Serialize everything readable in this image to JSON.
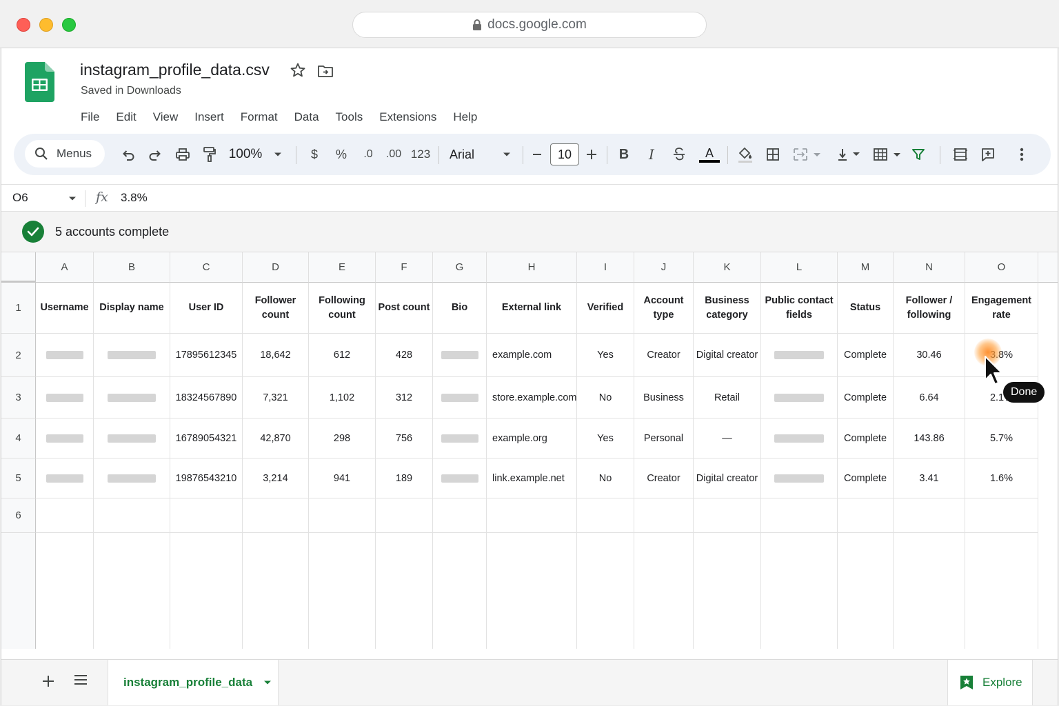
{
  "browser": {
    "url": "docs.google.com"
  },
  "doc": {
    "title": "instagram_profile_data.csv",
    "subtitle": "Saved in Downloads"
  },
  "menu": [
    "File",
    "Edit",
    "View",
    "Insert",
    "Format",
    "Data",
    "Tools",
    "Extensions",
    "Help"
  ],
  "toolbar": {
    "menus_label": "Menus",
    "zoom": "100%",
    "currency": "$",
    "percent": "%",
    "decrease_decimal": ".0",
    "increase_decimal": ".00",
    "number_format": "123",
    "font": "Arial",
    "font_size": "10",
    "bold": "B",
    "italic": "I",
    "text_color_letter": "A"
  },
  "formula_bar": {
    "cell_ref": "O6",
    "fx": "fx",
    "value": "3.8%"
  },
  "status": {
    "text": "5 accounts complete",
    "color": "#188038"
  },
  "columns": [
    "A",
    "B",
    "C",
    "D",
    "E",
    "F",
    "G",
    "H",
    "I",
    "J",
    "K",
    "L",
    "M",
    "N",
    "O"
  ],
  "row_numbers": [
    "1",
    "2",
    "3",
    "4",
    "5",
    "6"
  ],
  "headers": [
    "Username",
    "Display name",
    "User ID",
    "Follower count",
    "Following count",
    "Post count",
    "Bio",
    "External link",
    "Verified",
    "Account type",
    "Business category",
    "Public contact fields",
    "Status",
    "Follower / following",
    "Engagement rate"
  ],
  "rows": [
    [
      "",
      "",
      "17895612345",
      "18,642",
      "612",
      "428",
      "",
      "example.com",
      "Yes",
      "Creator",
      "Digital creator",
      "",
      "Complete",
      "30.46",
      "3.8%"
    ],
    [
      "",
      "",
      "18324567890",
      "7,321",
      "1,102",
      "312",
      "",
      "store.example.com",
      "No",
      "Business",
      "Retail",
      "",
      "Complete",
      "6.64",
      "2.1%"
    ],
    [
      "",
      "",
      "16789054321",
      "42,870",
      "298",
      "756",
      "",
      "example.org",
      "Yes",
      "Personal",
      "—",
      "",
      "Complete",
      "143.86",
      "5.7%"
    ],
    [
      "",
      "",
      "19876543210",
      "3,214",
      "941",
      "189",
      "",
      "link.example.net",
      "No",
      "Creator",
      "Digital creator",
      "",
      "Complete",
      "3.41",
      "1.6%"
    ]
  ],
  "cursor_tooltip": "Done",
  "sheet_tab": {
    "name": "instagram_profile_data"
  },
  "explore": {
    "label": "Explore"
  },
  "colors": {
    "brand_green": "#188038",
    "toolbar_bg": "#eef2f8"
  }
}
